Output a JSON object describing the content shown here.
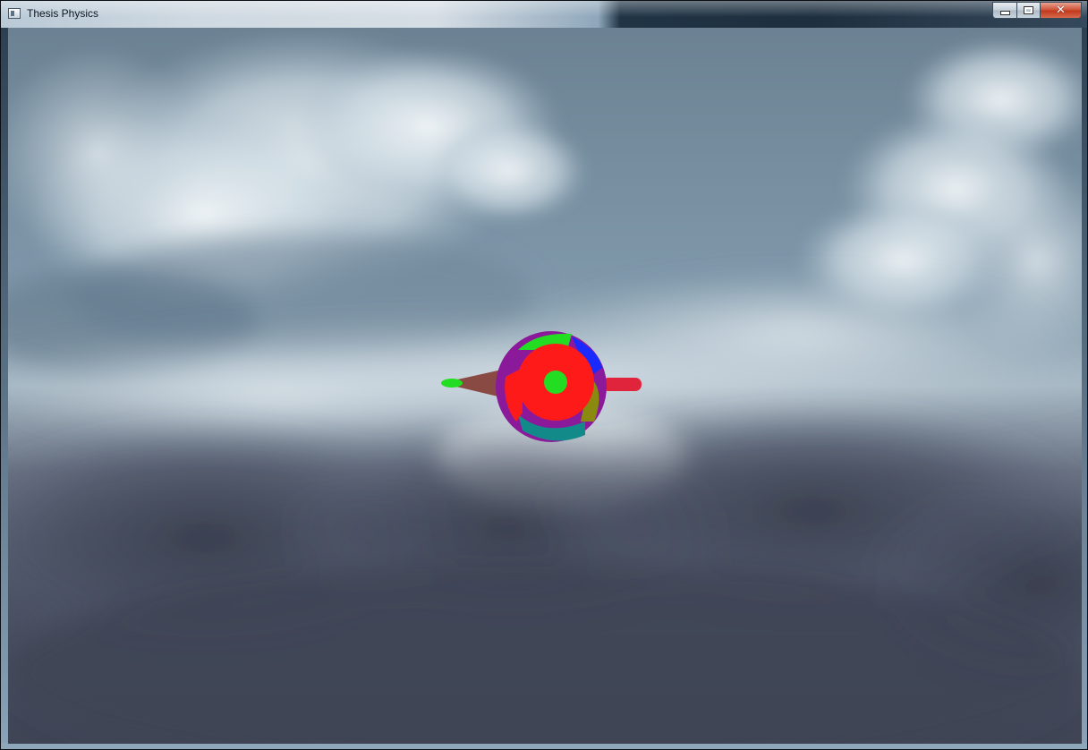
{
  "window": {
    "title": "Thesis Physics",
    "controls": {
      "minimize": "minimize",
      "maximize": "maximize",
      "close": "close"
    }
  },
  "scene": {
    "background": "sky-clouds",
    "colors": {
      "sky": "#6f8699",
      "cloud_light": "#e6eef2",
      "cloud_dark": "#3f4656",
      "object_red": "#ff1a1a",
      "object_green": "#22dd22",
      "object_purple": "#8a1a9a",
      "object_blue": "#1a2aff",
      "object_teal": "#138a8a",
      "object_olive": "#8a8a10",
      "object_brown": "#8a4a44",
      "rod_red": "#e0243c"
    }
  }
}
